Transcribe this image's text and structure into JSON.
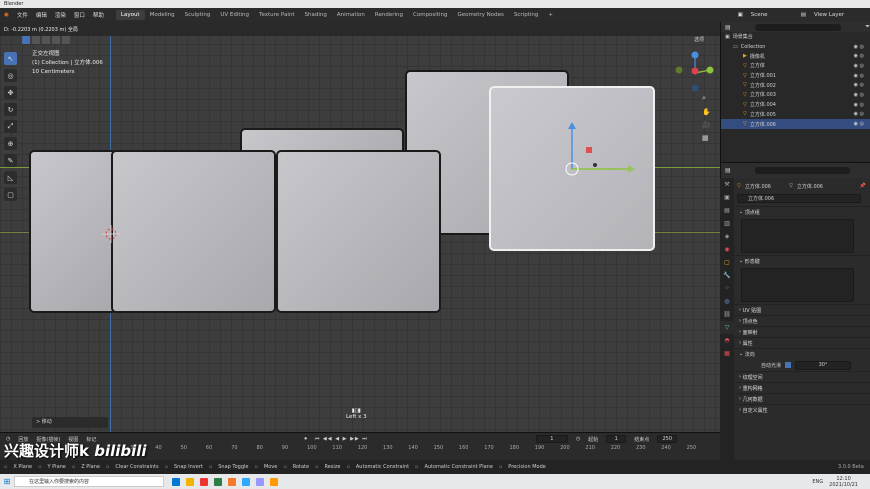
{
  "window": {
    "title": "Blender"
  },
  "menu": [
    "文件",
    "编辑",
    "渲染",
    "窗口",
    "帮助"
  ],
  "workspaces": [
    "Layout",
    "Modeling",
    "Sculpting",
    "UV Editing",
    "Texture Paint",
    "Shading",
    "Animation",
    "Rendering",
    "Compositing",
    "Geometry Nodes",
    "Scripting",
    "+"
  ],
  "scene": {
    "label": "Scene",
    "view_layer": "View Layer"
  },
  "viewport": {
    "move_readout": "D: -0.2203 m (0.2203 m) 全局",
    "info_line1": "正交左视图",
    "info_line2": "(1) Collection | 立方体.006",
    "info_line3": "10 Centimeters",
    "view_mode": "选项",
    "operator_panel": "> 移动",
    "repeat_label": "Left x 3"
  },
  "outliner": {
    "root": "场景集合",
    "collection": "Collection",
    "items": [
      "摄像机",
      "立方体",
      "立方体.001",
      "立方体.002",
      "立方体.003",
      "立方体.004",
      "立方体.005",
      "立方体.006"
    ]
  },
  "properties": {
    "object_name": "立方体.006",
    "mesh_name": "立方体.006",
    "data_field": "立方体.006",
    "sections": {
      "vertex_groups": "顶点组",
      "shape_keys": "形态键",
      "uv_maps": "UV 贴图",
      "color_attrs": "顶点色",
      "face_maps": "面映射",
      "attributes": "属性",
      "normals": "法向",
      "auto_smooth": "自动光滑",
      "auto_smooth_angle": "30°",
      "texture_space": "纹理空间",
      "remesh": "重构网格",
      "geometry_data": "几何数据",
      "custom_props": "自定义属性"
    }
  },
  "timeline": {
    "menus": [
      "回放",
      "抠像(插帧)",
      "视图",
      "标记"
    ],
    "current_frame": "1",
    "start_label": "起始",
    "start": "1",
    "end_label": "结束点",
    "end": "250",
    "ticks": [
      "30",
      "40",
      "50",
      "60",
      "70",
      "80",
      "90",
      "100",
      "110",
      "120",
      "130",
      "140",
      "150",
      "160",
      "170",
      "180",
      "190",
      "200",
      "210",
      "220",
      "230",
      "240",
      "250"
    ]
  },
  "statusbar": [
    "X Plane",
    "Y Plane",
    "Z Plane",
    "Clear Constraints",
    "Snap Invert",
    "Snap Toggle",
    "Move",
    "Rotate",
    "Resize",
    "Automatic Constraint",
    "Automatic Constraint Plane",
    "Precision Mode"
  ],
  "version": "3.0.0 Beta",
  "watermark": "兴趣设计师k",
  "watermark_logo": "bilibili",
  "taskbar": {
    "search": "在这里输入你要搜索的内容",
    "time": "12:10",
    "date": "2021/10/21",
    "lang": "ENG"
  }
}
